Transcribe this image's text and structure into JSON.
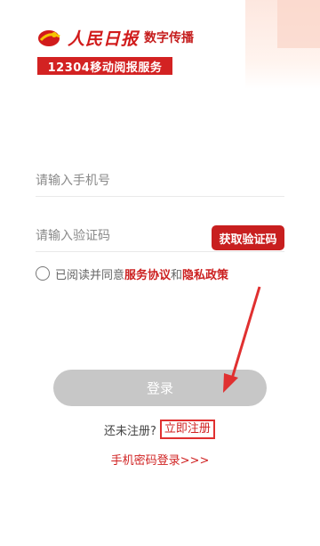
{
  "logo": {
    "brand": "人民日报",
    "subtitle": "数字传播",
    "banner": "12304移动阅报服务"
  },
  "form": {
    "phone_placeholder": "请输入手机号",
    "code_placeholder": "请输入验证码",
    "get_code_label": "获取验证码"
  },
  "agreement": {
    "prefix": "已阅读并同意",
    "service_link": "服务协议",
    "and": "和",
    "privacy_link": "隐私政策"
  },
  "login_label": "登录",
  "register": {
    "prompt": "还未注册?",
    "link": "立即注册"
  },
  "password_login_label": "手机密码登录>>>",
  "colors": {
    "brand_red": "#d32222",
    "login_disabled": "#c7c7c7",
    "annotation_red": "#e03030"
  }
}
